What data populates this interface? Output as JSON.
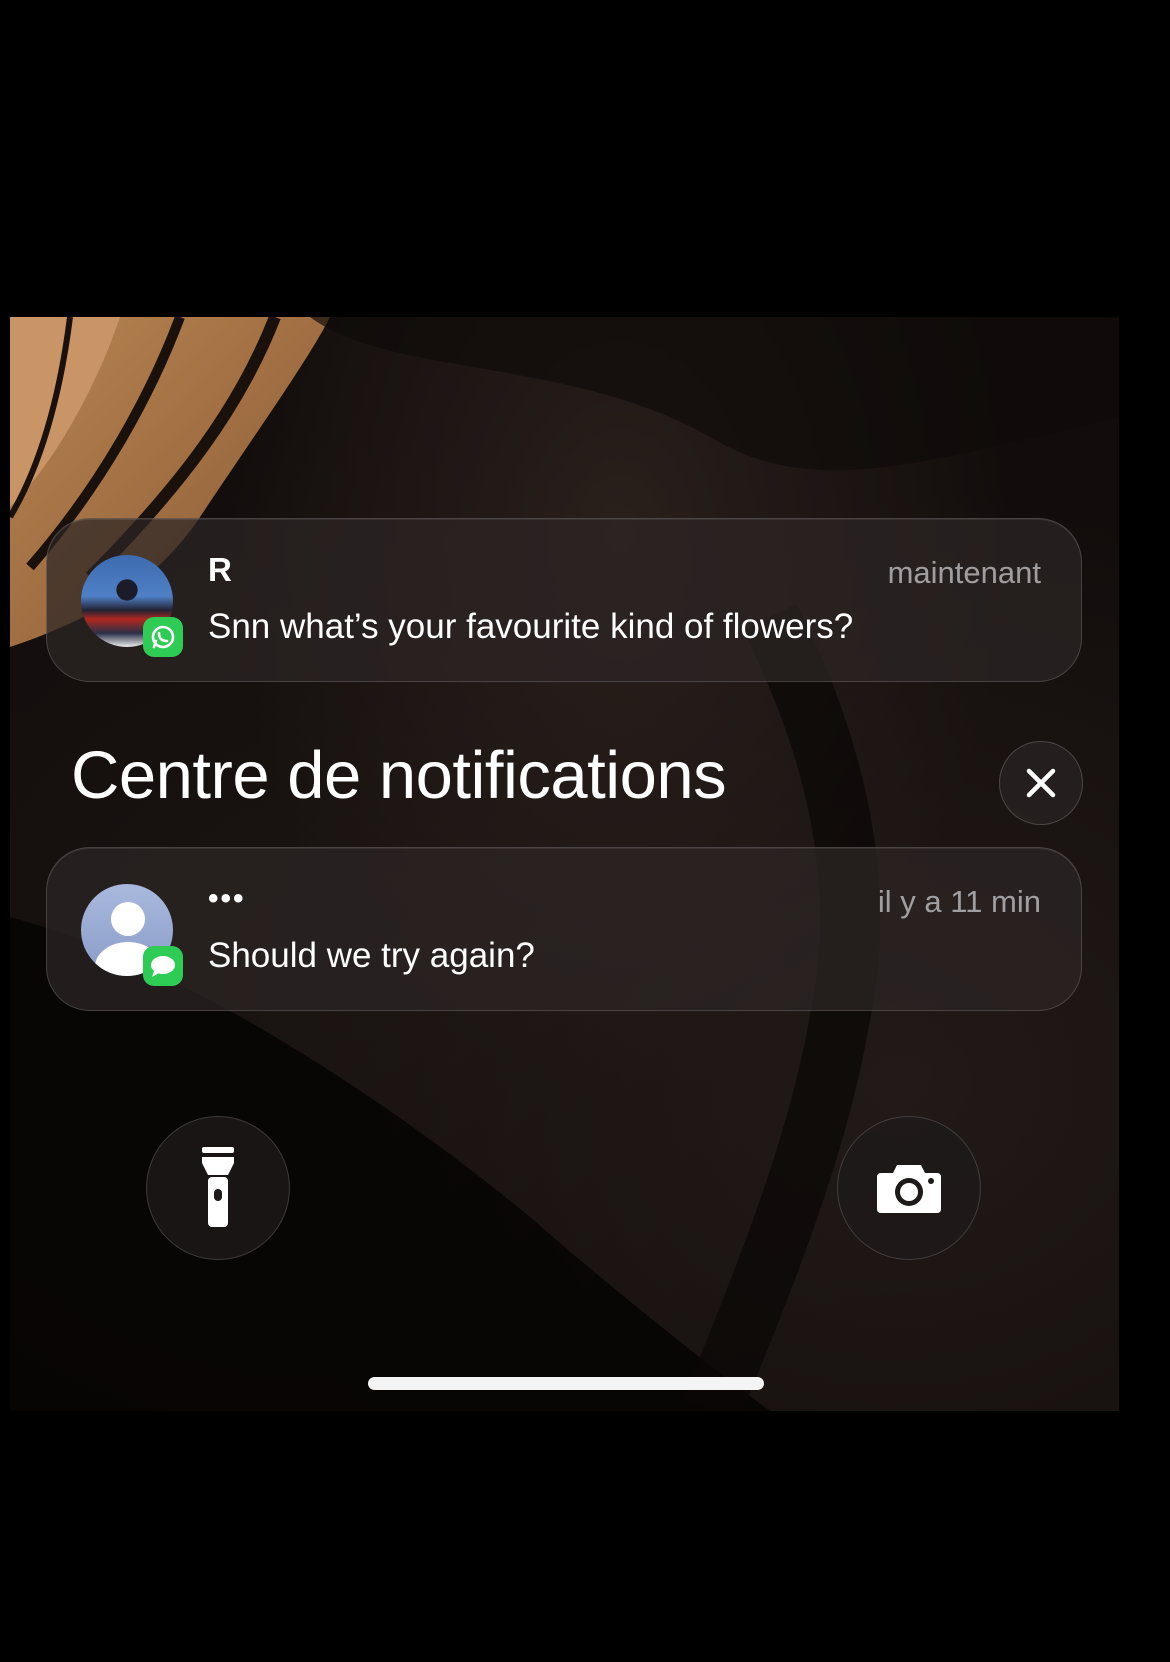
{
  "notifications": [
    {
      "sender": "R",
      "time": "maintenant",
      "message": "Snn what’s your favourite kind of flowers?",
      "app_icon": "whatsapp-icon",
      "app_color": "#2ecc55"
    },
    {
      "sender": "•••",
      "time": "il y a 11 min",
      "message": "Should we try again?",
      "app_icon": "messages-icon",
      "app_color": "#2ecc55"
    }
  ],
  "notification_center": {
    "title": "Centre de notifications",
    "close_icon": "close-icon"
  },
  "quick_actions": {
    "left_icon": "flashlight-icon",
    "right_icon": "camera-icon"
  }
}
